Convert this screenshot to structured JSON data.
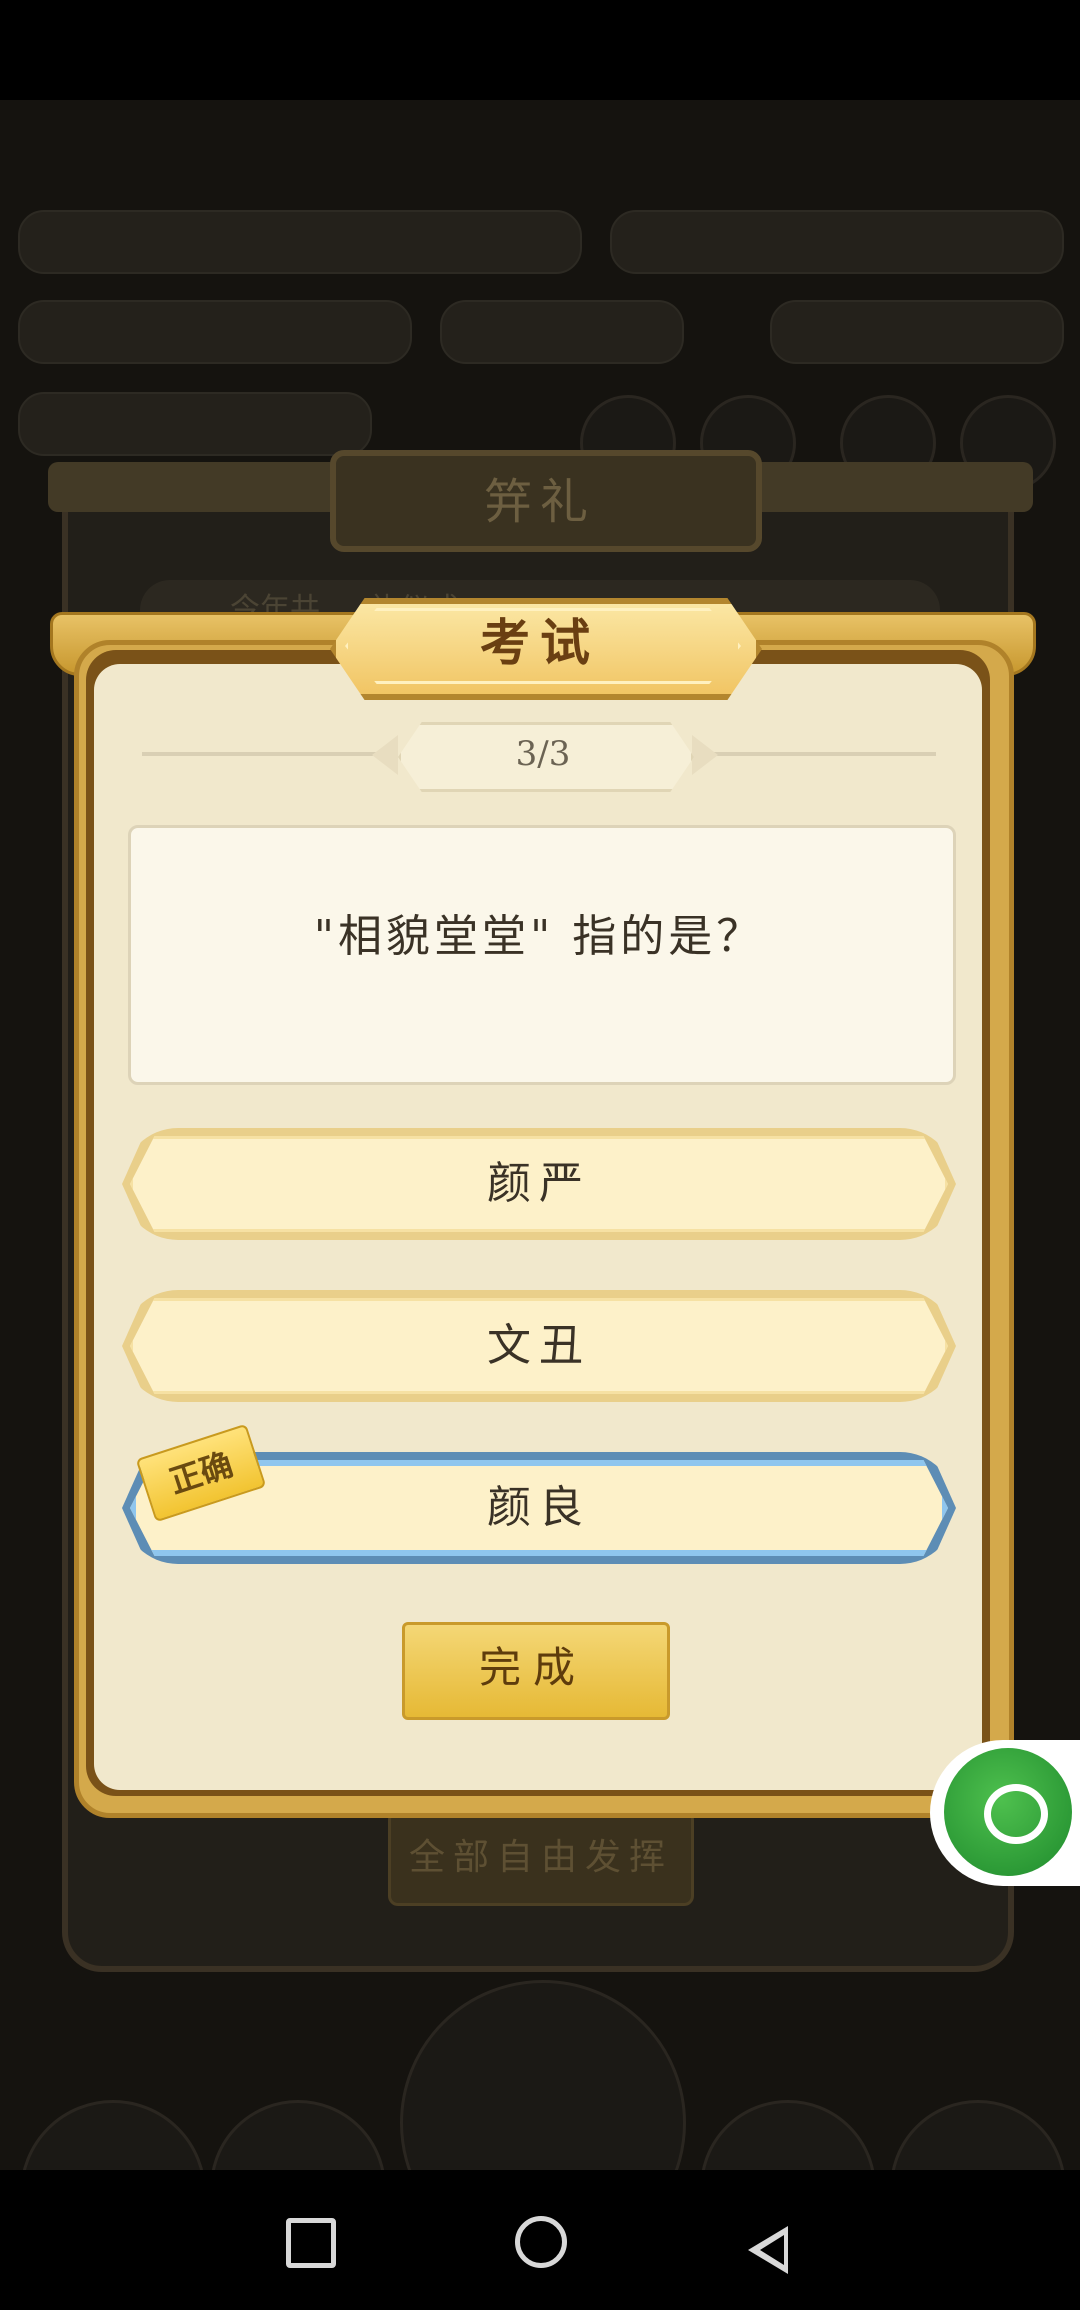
{
  "dialog": {
    "back_title": "笄礼",
    "back_button_label": "全部自由发挥",
    "back_strip_text": "今年共 … 礼仪式"
  },
  "exam": {
    "title": "考试",
    "progress": "3/3",
    "question": "\"相貌堂堂\" 指的是？",
    "options": [
      {
        "label": "颜严",
        "state": "normal"
      },
      {
        "label": "文丑",
        "state": "normal"
      },
      {
        "label": "颜良",
        "state": "correct"
      }
    ],
    "correct_tag": "正确",
    "done_button": "完成"
  },
  "floating": {
    "icon": "chat-bubble-icon",
    "color": "#2ea03a"
  },
  "navbar": {
    "icons": [
      "recent-apps-icon",
      "home-icon",
      "back-icon"
    ]
  },
  "colors": {
    "accent_gold": "#f1c564",
    "correct_blue": "#8fc6ee",
    "panel": "#f1e8cc"
  }
}
